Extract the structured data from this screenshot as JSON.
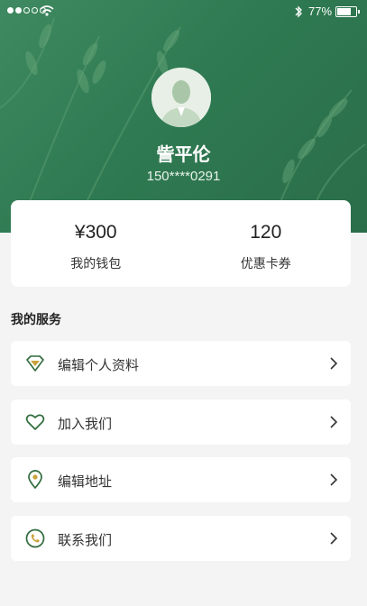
{
  "status_bar": {
    "battery_percent": "77%",
    "battery_level": 0.77
  },
  "profile": {
    "name": "訾平伦",
    "phone": "150****0291"
  },
  "stats": [
    {
      "value": "¥300",
      "label": "我的钱包"
    },
    {
      "value": "120",
      "label": "优惠卡券"
    }
  ],
  "services": {
    "title": "我的服务",
    "items": [
      {
        "label": "编辑个人资料",
        "icon": "diamond-icon"
      },
      {
        "label": "加入我们",
        "icon": "heart-icon"
      },
      {
        "label": "编辑地址",
        "icon": "location-pin-icon"
      },
      {
        "label": "联系我们",
        "icon": "phone-icon"
      }
    ]
  },
  "colors": {
    "brand_green": "#2f7a52",
    "icon_green": "#2f6b3c",
    "icon_gold": "#c9a23a"
  }
}
